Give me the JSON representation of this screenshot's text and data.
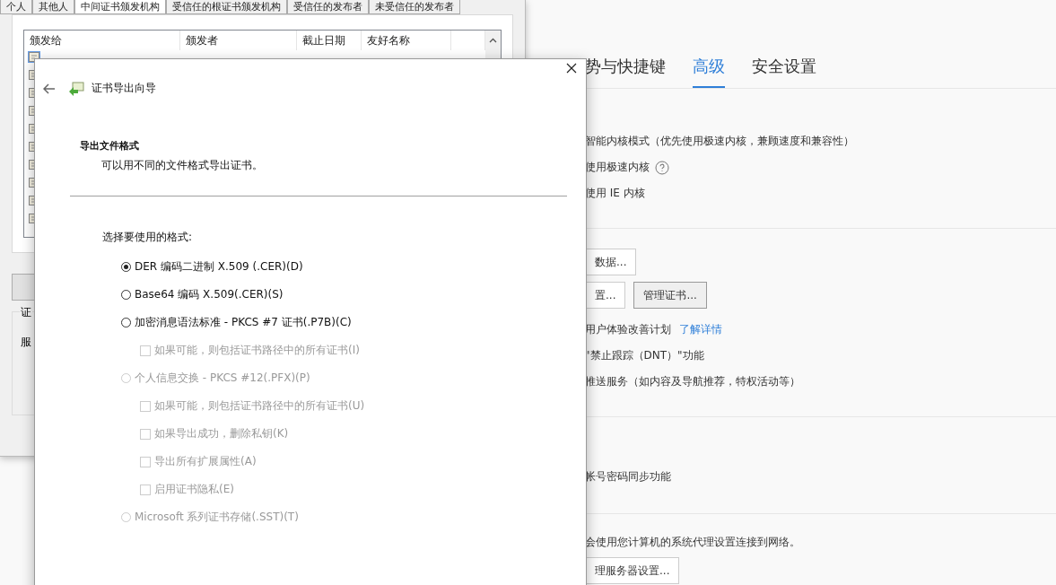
{
  "settings_page": {
    "tabs": [
      {
        "label": "势与快捷键",
        "selected": false
      },
      {
        "label": "高级",
        "selected": true
      },
      {
        "label": "安全设置",
        "selected": false
      }
    ],
    "kernel_options": [
      "智能内核模式（优先使用极速内核，兼顾速度和兼容性）",
      "使用极速内核",
      "使用 IE 内核"
    ],
    "data_buttons": [
      "数据..."
    ],
    "cert_buttons": [
      "置...",
      "管理证书..."
    ],
    "privacy": {
      "text": "用户体验改善计划",
      "link": "了解详情"
    },
    "privacy_options": [
      "\"禁止跟踪（DNT）\"功能",
      "推送服务（如内容及导航推荐，特权活动等）"
    ],
    "sync_option": "帐号密码同步功能",
    "proxy_text": "会使用您计算机的系统代理设置连接到网络。",
    "proxy_button": "理服务器设置..."
  },
  "cert_manager": {
    "tabs": [
      {
        "label": "个人",
        "selected": false
      },
      {
        "label": "其他人",
        "selected": false
      },
      {
        "label": "中间证书颁发机构",
        "selected": true
      },
      {
        "label": "受信任的根证书颁发机构",
        "selected": false
      },
      {
        "label": "受信任的发布者",
        "selected": false
      },
      {
        "label": "未受信任的发布者",
        "selected": false
      }
    ],
    "columns": [
      "颁发给",
      "颁发者",
      "截止日期",
      "友好名称"
    ],
    "rows": [
      {
        "selected": true
      },
      {
        "selected": false
      },
      {
        "selected": false
      },
      {
        "selected": false
      },
      {
        "selected": false
      },
      {
        "selected": false
      },
      {
        "selected": false
      },
      {
        "selected": false
      },
      {
        "selected": false
      },
      {
        "selected": false
      }
    ],
    "group_label": "证",
    "group_text": "服"
  },
  "wizard": {
    "title": "证书导出向导",
    "heading": "导出文件格式",
    "subheading": "可以用不同的文件格式导出证书。",
    "prompt": "选择要使用的格式:",
    "options": [
      {
        "kind": "radio",
        "label": "DER 编码二进制 X.509 (.CER)(D)",
        "selected": true,
        "disabled": false
      },
      {
        "kind": "radio",
        "label": "Base64 编码 X.509(.CER)(S)",
        "selected": false,
        "disabled": false
      },
      {
        "kind": "radio",
        "label": "加密消息语法标准 - PKCS #7 证书(.P7B)(C)",
        "selected": false,
        "disabled": false
      },
      {
        "kind": "checkbox",
        "label": "如果可能，则包括证书路径中的所有证书(I)",
        "checked": false,
        "disabled": true
      },
      {
        "kind": "radio",
        "label": "个人信息交换 - PKCS #12(.PFX)(P)",
        "selected": false,
        "disabled": true
      },
      {
        "kind": "checkbox",
        "label": "如果可能，则包括证书路径中的所有证书(U)",
        "checked": false,
        "disabled": true
      },
      {
        "kind": "checkbox",
        "label": "如果导出成功，删除私钥(K)",
        "checked": false,
        "disabled": true
      },
      {
        "kind": "checkbox",
        "label": "导出所有扩展属性(A)",
        "checked": false,
        "disabled": true
      },
      {
        "kind": "checkbox",
        "label": "启用证书隐私(E)",
        "checked": false,
        "disabled": true
      },
      {
        "kind": "radio",
        "label": "Microsoft 系列证书存储(.SST)(T)",
        "selected": false,
        "disabled": true
      }
    ]
  }
}
